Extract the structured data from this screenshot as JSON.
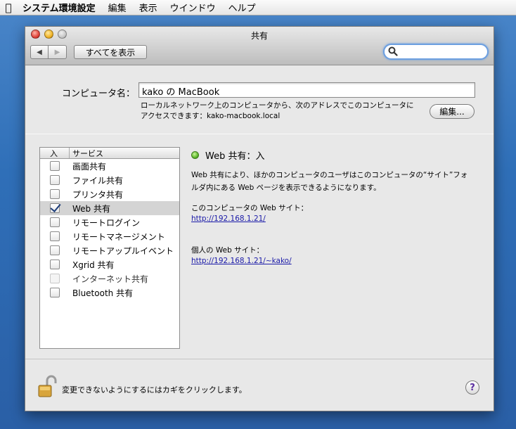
{
  "menubar": {
    "apple_icon": "apple-icon",
    "app_name": "システム環境設定",
    "items": [
      "編集",
      "表示",
      "ウインドウ",
      "ヘルプ"
    ]
  },
  "window": {
    "title": "共有",
    "nav": {
      "back_icon": "back-arrow-icon",
      "forward_icon": "forward-arrow-icon"
    },
    "show_all_label": "すべてを表示",
    "search": {
      "value": "",
      "placeholder": ""
    }
  },
  "computer": {
    "label": "コンピュータ名：",
    "name_value": "kako の MacBook",
    "description_line1": "ローカルネットワーク上のコンピュータから、次のアドレスでこのコンピュータに",
    "description_line2": "アクセスできます：kako-macbook.local",
    "edit_label": "編集..."
  },
  "services": {
    "col_on": "入",
    "col_service": "サービス",
    "items": [
      {
        "label": "画面共有",
        "checked": false,
        "selected": false,
        "disabled": false
      },
      {
        "label": "ファイル共有",
        "checked": false,
        "selected": false,
        "disabled": false
      },
      {
        "label": "プリンタ共有",
        "checked": false,
        "selected": false,
        "disabled": false
      },
      {
        "label": "Web 共有",
        "checked": true,
        "selected": true,
        "disabled": false
      },
      {
        "label": "リモートログイン",
        "checked": false,
        "selected": false,
        "disabled": false
      },
      {
        "label": "リモートマネージメント",
        "checked": false,
        "selected": false,
        "disabled": false
      },
      {
        "label": "リモートアップルイベント",
        "checked": false,
        "selected": false,
        "disabled": false
      },
      {
        "label": "Xgrid 共有",
        "checked": false,
        "selected": false,
        "disabled": false
      },
      {
        "label": "インターネット共有",
        "checked": false,
        "selected": false,
        "disabled": true
      },
      {
        "label": "Bluetooth 共有",
        "checked": false,
        "selected": false,
        "disabled": false
      }
    ]
  },
  "detail": {
    "status": "Web 共有：入",
    "status_color": "#5fb82c",
    "desc_line1": "Web 共有により、ほかのコンピュータのユーザはこのコンピュータの“サイト”フォ",
    "desc_line2": "ルダ内にある Web ページを表示できるようになります。",
    "computer_site_label": "このコンピュータの Web サイト：",
    "computer_site_url": "http://192.168.1.21/",
    "personal_site_label": "個人の Web サイト：",
    "personal_site_url": "http://192.168.1.21/~kako/"
  },
  "footer": {
    "lock_text": "変更できないようにするにはカギをクリックします。",
    "help_label": "?"
  }
}
